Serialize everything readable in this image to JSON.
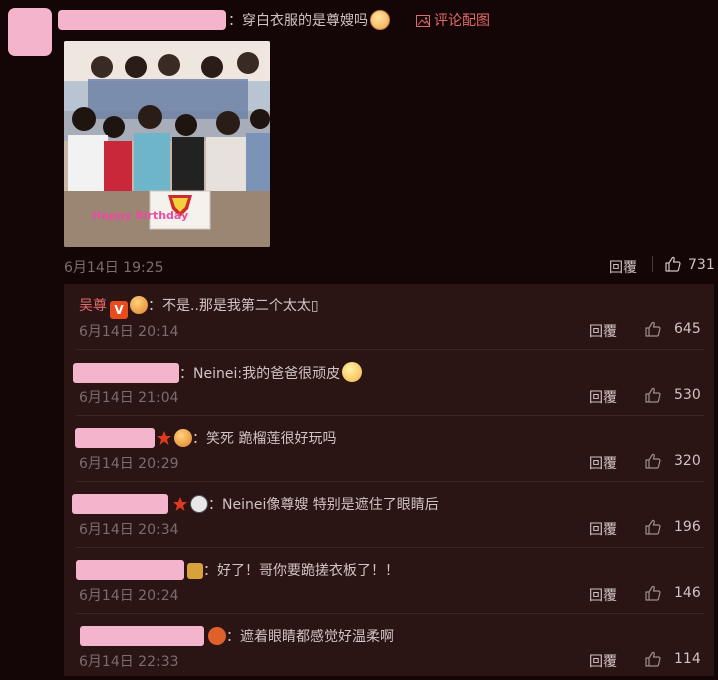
{
  "main_comment": {
    "text": "：穿白衣服的是尊嫂吗",
    "attach_label": "评论配图",
    "photo_caption": "Happy Birthday",
    "date": "6月14日 19:25",
    "reply_label": "回覆",
    "likes": "731"
  },
  "replies": [
    {
      "name": "吴尊",
      "text": "：不是..那是我第二个太太▯",
      "date": "6月14日 20:14",
      "reply_label": "回覆",
      "likes": "645"
    },
    {
      "text": "：Neinei:我的爸爸很顽皮",
      "date": "6月14日 21:04",
      "reply_label": "回覆",
      "likes": "530"
    },
    {
      "text": "：笑死 跪榴莲很好玩吗",
      "date": "6月14日 20:29",
      "reply_label": "回覆",
      "likes": "320"
    },
    {
      "text": "：Neinei像尊嫂 特别是遮住了眼睛后",
      "date": "6月14日 20:34",
      "reply_label": "回覆",
      "likes": "196"
    },
    {
      "text": "：好了！哥你要跪搓衣板了！！",
      "date": "6月14日 20:24",
      "reply_label": "回覆",
      "likes": "146"
    },
    {
      "text": "：遮着眼睛都感觉好温柔啊",
      "date": "6月14日 22:33",
      "reply_label": "回覆",
      "likes": "114"
    }
  ],
  "colors": {
    "background": "#140607",
    "reply_panel": "#2b1414",
    "accent": "#e36a6a",
    "redacted": "#f4b5cc"
  },
  "icons": [
    "image-icon",
    "thumbs-up-icon",
    "verified-v-icon",
    "star-badge-icon"
  ]
}
